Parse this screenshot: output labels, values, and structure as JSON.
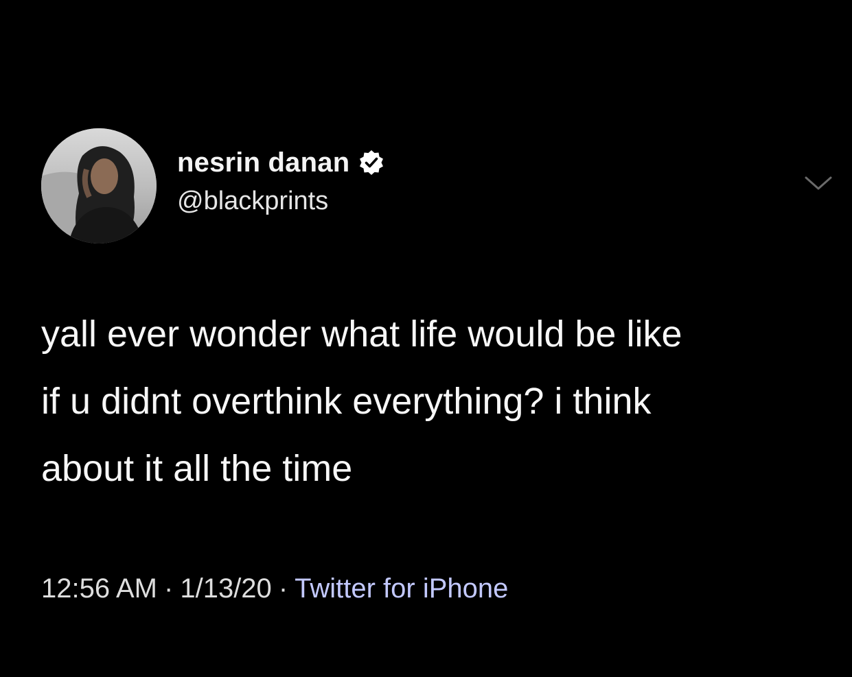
{
  "tweet": {
    "author": {
      "display_name": "nesrin danan",
      "handle": "@blackprints",
      "verified": true
    },
    "text_lines": [
      "yall ever wonder what life would be like",
      "if u didnt overthink everything? i think",
      "about it all the time"
    ],
    "meta": {
      "time": "12:56 AM",
      "separator": "·",
      "date": "1/13/20",
      "source": "Twitter for iPhone"
    }
  },
  "colors": {
    "background": "#000000",
    "text": "#f7f7f7",
    "source_link": "#c3c9ff",
    "verified_badge": "#ffffff"
  },
  "icons": {
    "verified": "verified-badge-icon",
    "more": "chevron-down-icon"
  }
}
